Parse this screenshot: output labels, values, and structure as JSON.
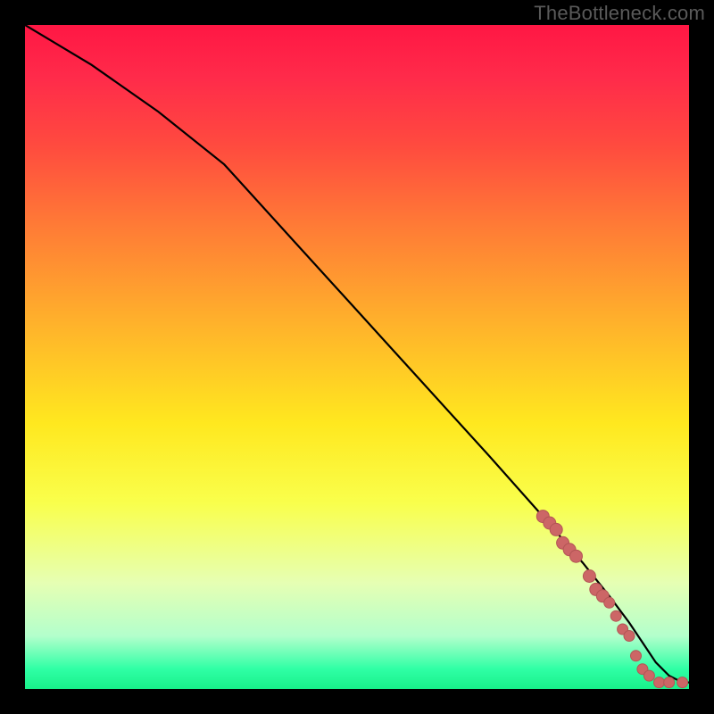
{
  "watermark": "TheBottleneck.com",
  "colors": {
    "line": "#000000",
    "dot_fill": "#cc6666",
    "dot_stroke": "#b35555",
    "background": "#000000"
  },
  "chart_data": {
    "type": "line",
    "title": "",
    "xlabel": "",
    "ylabel": "",
    "xlim": [
      0,
      100
    ],
    "ylim": [
      0,
      100
    ],
    "series": [
      {
        "name": "curve",
        "x": [
          0,
          10,
          20,
          30,
          40,
          50,
          60,
          70,
          78,
          84,
          88,
          91,
          93,
          95,
          97,
          99,
          100
        ],
        "y": [
          100,
          94,
          87,
          79,
          68,
          57,
          46,
          35,
          26,
          19,
          14,
          10,
          7,
          4,
          2,
          1,
          1
        ]
      }
    ],
    "scatter": {
      "name": "dots",
      "points": [
        {
          "x": 78,
          "y": 26,
          "r": 7
        },
        {
          "x": 79,
          "y": 25,
          "r": 7
        },
        {
          "x": 80,
          "y": 24,
          "r": 7
        },
        {
          "x": 81,
          "y": 22,
          "r": 7
        },
        {
          "x": 82,
          "y": 21,
          "r": 7
        },
        {
          "x": 83,
          "y": 20,
          "r": 7
        },
        {
          "x": 85,
          "y": 17,
          "r": 7
        },
        {
          "x": 86,
          "y": 15,
          "r": 7
        },
        {
          "x": 87,
          "y": 14,
          "r": 7
        },
        {
          "x": 88,
          "y": 13,
          "r": 6
        },
        {
          "x": 89,
          "y": 11,
          "r": 6
        },
        {
          "x": 90,
          "y": 9,
          "r": 6
        },
        {
          "x": 91,
          "y": 8,
          "r": 6
        },
        {
          "x": 92,
          "y": 5,
          "r": 6
        },
        {
          "x": 93,
          "y": 3,
          "r": 6
        },
        {
          "x": 94,
          "y": 2,
          "r": 6
        },
        {
          "x": 95.5,
          "y": 1,
          "r": 6
        },
        {
          "x": 97,
          "y": 1,
          "r": 6
        },
        {
          "x": 99,
          "y": 1,
          "r": 6
        }
      ]
    }
  }
}
